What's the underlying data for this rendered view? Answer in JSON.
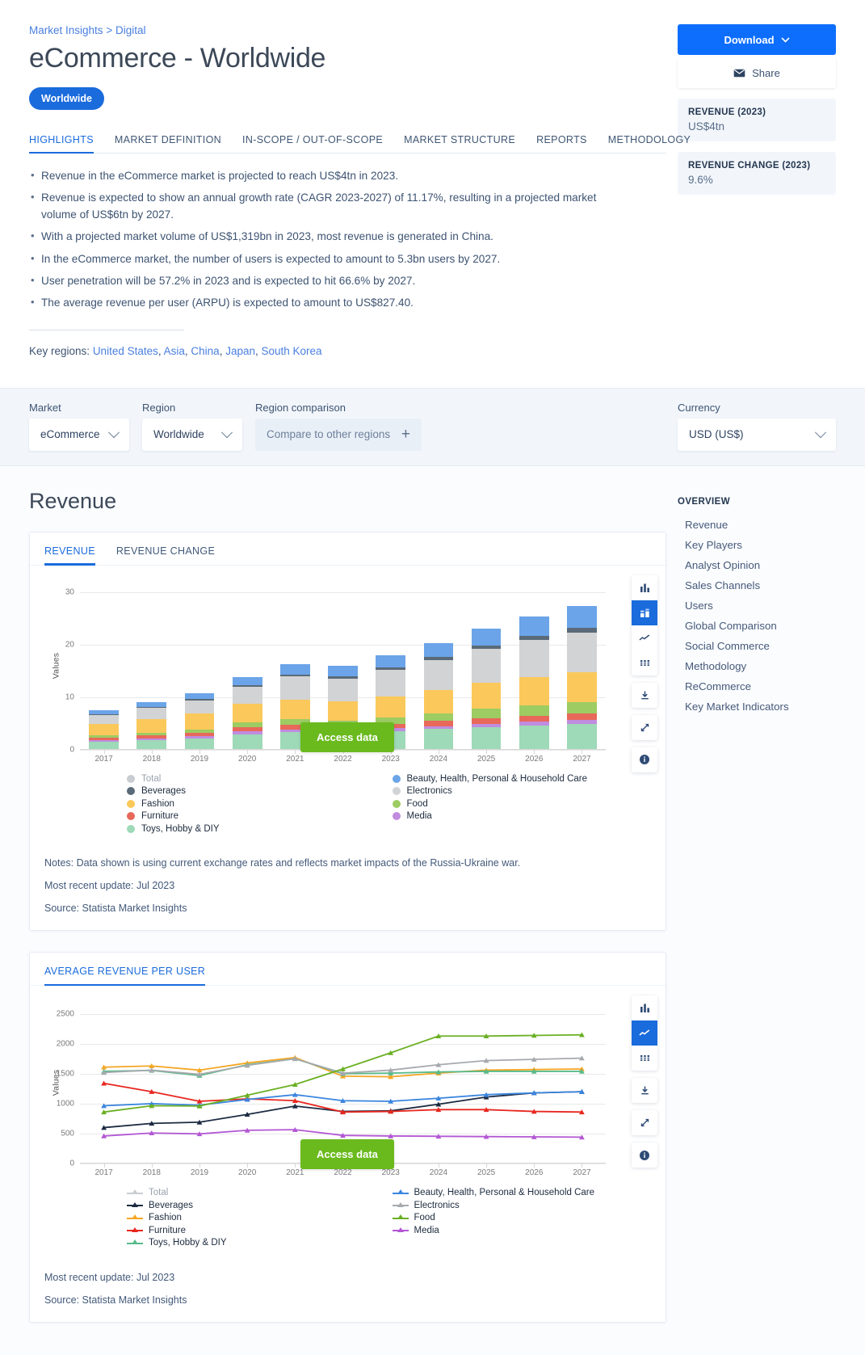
{
  "breadcrumb": {
    "root": "Market Insights",
    "sep": ">",
    "child": "Digital"
  },
  "header": {
    "title": "eCommerce - Worldwide",
    "region_pill": "Worldwide"
  },
  "actions": {
    "download_label": "Download",
    "share_label": "Share"
  },
  "kpis": [
    {
      "label": "REVENUE (2023)",
      "value": "US$4tn"
    },
    {
      "label": "REVENUE CHANGE (2023)",
      "value": "9.6%"
    }
  ],
  "tabs": [
    {
      "label": "HIGHLIGHTS",
      "active": true
    },
    {
      "label": "MARKET DEFINITION",
      "active": false
    },
    {
      "label": "IN-SCOPE / OUT-OF-SCOPE",
      "active": false
    },
    {
      "label": "MARKET STRUCTURE",
      "active": false
    },
    {
      "label": "REPORTS",
      "active": false
    },
    {
      "label": "METHODOLOGY",
      "active": false
    }
  ],
  "highlights": [
    "Revenue in the eCommerce market is projected to reach US$4tn in 2023.",
    "Revenue is expected to show an annual growth rate (CAGR 2023-2027) of 11.17%, resulting in a projected market volume of US$6tn by 2027.",
    "With a projected market volume of US$1,319bn in 2023, most revenue is generated in China.",
    "In the eCommerce market, the number of users is expected to amount to 5.3bn users by 2027.",
    "User penetration will be 57.2% in 2023 and is expected to hit 66.6% by 2027.",
    "The average revenue per user (ARPU) is expected to amount to US$827.40."
  ],
  "key_regions": {
    "label": "Key regions:",
    "items": [
      "United States",
      "Asia",
      "China",
      "Japan",
      "South Korea"
    ]
  },
  "filters": {
    "market": {
      "label": "Market",
      "value": "eCommerce"
    },
    "region": {
      "label": "Region",
      "value": "Worldwide"
    },
    "region_comparison": {
      "label": "Region comparison",
      "placeholder": "Compare to other regions"
    },
    "currency": {
      "label": "Currency",
      "value": "USD (US$)"
    }
  },
  "section": {
    "title": "Revenue"
  },
  "revenue_card": {
    "tabs": [
      {
        "label": "REVENUE",
        "active": true
      },
      {
        "label": "REVENUE CHANGE",
        "active": false
      }
    ],
    "access_data": "Access data",
    "notes": "Notes: Data shown is using current exchange rates and reflects market impacts of the Russia-Ukraine war.",
    "update": "Most recent update: Jul 2023",
    "source": "Source: Statista Market Insights"
  },
  "arpu_card": {
    "tabs": [
      {
        "label": "AVERAGE REVENUE PER USER",
        "active": true
      }
    ],
    "access_data": "Access data",
    "update": "Most recent update: Jul 2023",
    "source": "Source: Statista Market Insights"
  },
  "overview": {
    "title": "OVERVIEW",
    "items": [
      "Revenue",
      "Key Players",
      "Analyst Opinion",
      "Sales Channels",
      "Users",
      "Global Comparison",
      "Social Commerce",
      "Methodology",
      "ReCommerce",
      "Key Market Indicators"
    ]
  },
  "chart_data": [
    {
      "type": "bar",
      "stacked": true,
      "title": "Revenue",
      "xlabel": "",
      "ylabel": "Values",
      "ylim": [
        0,
        32
      ],
      "yticks": [
        0,
        10,
        20,
        30
      ],
      "grid": true,
      "legend_position": "bottom",
      "categories": [
        "2017",
        "2018",
        "2019",
        "2020",
        "2021",
        "2022",
        "2023",
        "2024",
        "2025",
        "2026",
        "2027"
      ],
      "series": [
        {
          "name": "Toys, Hobby & DIY",
          "color": "#9ed9b8",
          "values": [
            1.4,
            1.7,
            2.0,
            2.8,
            3.2,
            3.1,
            3.4,
            3.8,
            4.2,
            4.5,
            4.8
          ]
        },
        {
          "name": "Media",
          "color": "#c08ce0",
          "values": [
            0.3,
            0.35,
            0.4,
            0.5,
            0.5,
            0.45,
            0.5,
            0.55,
            0.6,
            0.65,
            0.7
          ]
        },
        {
          "name": "Furniture",
          "color": "#e8685a",
          "values": [
            0.5,
            0.6,
            0.7,
            0.9,
            0.9,
            0.85,
            0.9,
            1.0,
            1.1,
            1.2,
            1.25
          ]
        },
        {
          "name": "Food",
          "color": "#9dcc63",
          "values": [
            0.35,
            0.45,
            0.5,
            0.8,
            1.0,
            1.0,
            1.2,
            1.4,
            1.7,
            1.9,
            2.1
          ]
        },
        {
          "name": "Fashion",
          "color": "#fbc85b",
          "values": [
            2.2,
            2.6,
            3.1,
            3.6,
            3.8,
            3.7,
            4.0,
            4.5,
            5.0,
            5.4,
            5.7
          ]
        },
        {
          "name": "Electronics",
          "color": "#d2d3d4",
          "values": [
            1.7,
            2.1,
            2.5,
            3.2,
            4.4,
            4.3,
            5.0,
            5.7,
            6.4,
            7.1,
            7.6
          ]
        },
        {
          "name": "Beverages",
          "color": "#5a6a78",
          "values": [
            0.15,
            0.2,
            0.25,
            0.3,
            0.4,
            0.4,
            0.45,
            0.55,
            0.65,
            0.75,
            0.85
          ]
        },
        {
          "name": "Beauty, Health, Personal & Household Care",
          "color": "#6ba4e8",
          "values": [
            0.75,
            0.95,
            1.1,
            1.5,
            2.0,
            2.0,
            2.3,
            2.7,
            3.2,
            3.7,
            4.2
          ]
        }
      ],
      "total_series": {
        "name": "Total",
        "color": "#c9cdd2"
      }
    },
    {
      "type": "line",
      "title": "Average revenue per user",
      "xlabel": "",
      "ylabel": "Values",
      "ylim": [
        0,
        2700
      ],
      "yticks": [
        0,
        500,
        1000,
        1500,
        2000,
        2500
      ],
      "grid": true,
      "legend_position": "bottom",
      "x": [
        "2017",
        "2018",
        "2019",
        "2020",
        "2021",
        "2022",
        "2023",
        "2024",
        "2025",
        "2026",
        "2027"
      ],
      "series": [
        {
          "name": "Beverages",
          "color": "#1c2b42",
          "values": [
            600,
            670,
            690,
            820,
            960,
            870,
            880,
            990,
            1110,
            1180,
            1200
          ]
        },
        {
          "name": "Fashion",
          "color": "#f5a623",
          "values": [
            1610,
            1630,
            1560,
            1680,
            1770,
            1460,
            1450,
            1510,
            1560,
            1570,
            1580
          ]
        },
        {
          "name": "Furniture",
          "color": "#e8271f",
          "values": [
            1340,
            1200,
            1040,
            1080,
            1050,
            860,
            870,
            900,
            900,
            870,
            860
          ]
        },
        {
          "name": "Toys, Hobby & DIY",
          "color": "#57bb8a",
          "values": [
            1540,
            1555,
            1470,
            1650,
            1750,
            1500,
            1510,
            1530,
            1540,
            1540,
            1540
          ]
        },
        {
          "name": "Beauty, Health, Personal & Household Care",
          "color": "#3a86df",
          "values": [
            965,
            1000,
            975,
            1070,
            1150,
            1050,
            1040,
            1090,
            1150,
            1180,
            1200
          ]
        },
        {
          "name": "Electronics",
          "color": "#a6a9ae",
          "values": [
            1520,
            1560,
            1490,
            1640,
            1750,
            1510,
            1560,
            1650,
            1720,
            1740,
            1760
          ]
        },
        {
          "name": "Food",
          "color": "#6ab023",
          "values": [
            860,
            965,
            960,
            1140,
            1320,
            1580,
            1850,
            2130,
            2130,
            2140,
            2150
          ]
        },
        {
          "name": "Media",
          "color": "#b357d4",
          "values": [
            460,
            510,
            495,
            555,
            565,
            470,
            460,
            455,
            450,
            445,
            440
          ]
        }
      ],
      "total_series": {
        "name": "Total",
        "color": "#c9cdd2"
      }
    }
  ],
  "icons": {
    "chevron_down": "chevron-down-icon",
    "envelope": "envelope-icon",
    "plus": "plus-icon"
  }
}
